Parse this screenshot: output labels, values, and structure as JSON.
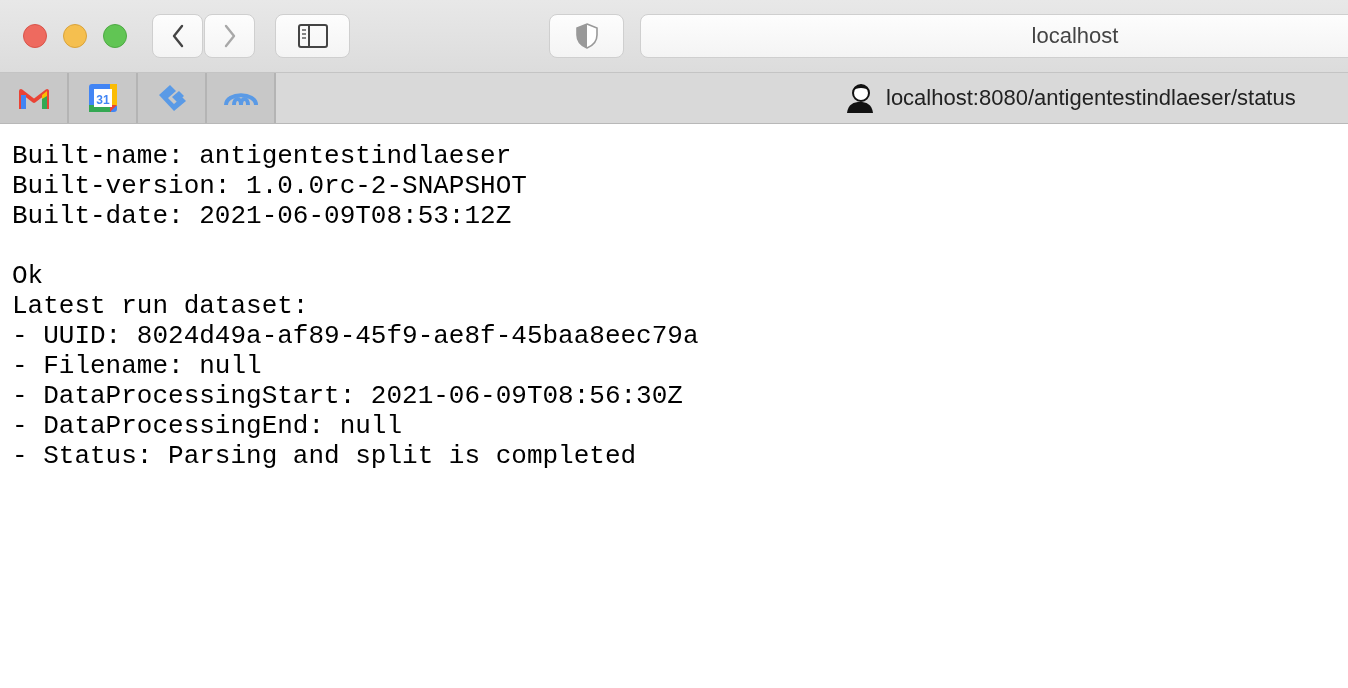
{
  "toolbar": {
    "back": {
      "disabled": false
    },
    "forward": {
      "disabled": true
    },
    "address": "localhost"
  },
  "tabs": [
    {
      "kind": "mail",
      "selected": false
    },
    {
      "kind": "calendar",
      "badge": "31",
      "selected": false
    },
    {
      "kind": "diamond",
      "selected": false
    },
    {
      "kind": "arches",
      "selected": false
    },
    {
      "kind": "page",
      "title": "localhost:8080/antigentestindlaeser/status",
      "selected": true
    }
  ],
  "build_info": [
    "Built-name: antigentestindlaeser",
    "Built-version: 1.0.0rc-2-SNAPSHOT",
    "Built-date: 2021-06-09T08:53:12Z"
  ],
  "status_lines": [
    "Ok",
    "Latest run dataset:",
    "- UUID: 8024d49a-af89-45f9-ae8f-45baa8eec79a",
    "- Filename: null",
    "- DataProcessingStart: 2021-06-09T08:56:30Z",
    "- DataProcessingEnd: null",
    "- Status: Parsing and split is completed"
  ]
}
